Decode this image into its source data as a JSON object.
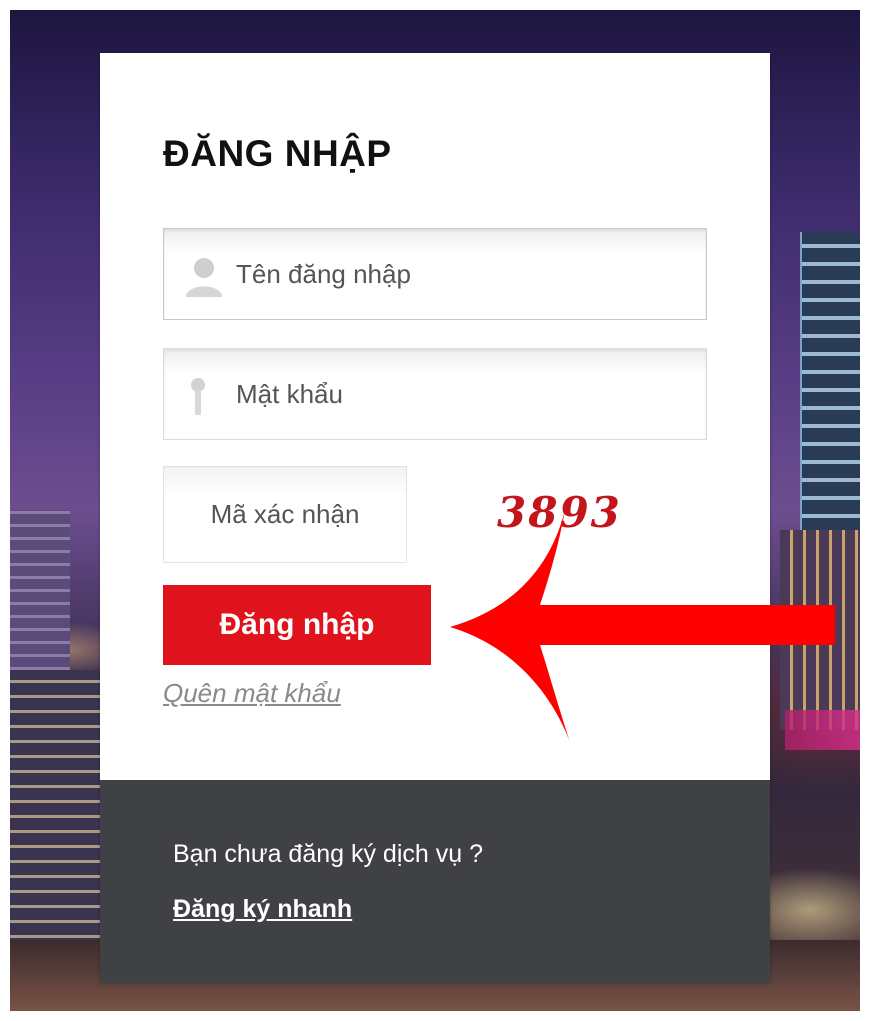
{
  "login": {
    "title": "ĐĂNG NHẬP",
    "username_placeholder": "Tên đăng nhập",
    "password_placeholder": "Mật khẩu",
    "captcha_placeholder": "Mã xác nhận",
    "captcha_code": "3893",
    "submit_label": "Đăng nhập",
    "forgot_password": "Quên mật khẩu"
  },
  "footer": {
    "question": "Bạn chưa đăng ký dịch vụ ?",
    "register_link": "Đăng ký nhanh"
  },
  "icons": {
    "username": "user-icon",
    "password": "key-icon",
    "annotation": "red-arrow-icon"
  },
  "colors": {
    "accent": "#e0131d",
    "footer_bg": "#3f4144",
    "captcha_text": "#c4141c"
  }
}
